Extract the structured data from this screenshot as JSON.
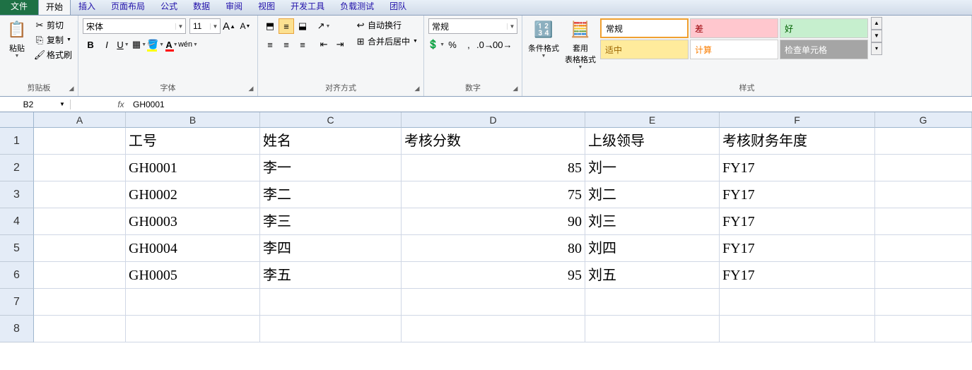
{
  "tabs": {
    "file": "文件",
    "items": [
      "开始",
      "插入",
      "页面布局",
      "公式",
      "数据",
      "审阅",
      "视图",
      "开发工具",
      "负载测试",
      "团队"
    ],
    "active": 0
  },
  "ribbon": {
    "clipboard": {
      "label": "剪贴板",
      "paste": "粘贴",
      "cut": "剪切",
      "copy": "复制",
      "format_painter": "格式刷"
    },
    "font": {
      "label": "字体",
      "name": "宋体",
      "size": "11"
    },
    "alignment": {
      "label": "对齐方式",
      "wrap": "自动换行",
      "merge": "合并后居中"
    },
    "number": {
      "label": "数字",
      "format": "常规"
    },
    "styles": {
      "label": "样式",
      "cond_fmt": "条件格式",
      "table_fmt": "套用\n表格格式",
      "cells": [
        {
          "t": "常规",
          "bg": "#ffffff",
          "bd": "#f0c36d",
          "sel": true
        },
        {
          "t": "差",
          "bg": "#ffc7ce",
          "c": "#9c0006"
        },
        {
          "t": "好",
          "bg": "#c6efce",
          "c": "#006100"
        },
        {
          "t": "适中",
          "bg": "#ffeb9c",
          "c": "#9c6500"
        },
        {
          "t": "计算",
          "bg": "#ffffff",
          "c": "#fa7d00"
        },
        {
          "t": "检查单元格",
          "bg": "#a5a5a5",
          "c": "#ffffff"
        }
      ]
    }
  },
  "formula_bar": {
    "name_box": "B2",
    "fx": "fx",
    "value": "GH0001"
  },
  "grid": {
    "columns": [
      "A",
      "B",
      "C",
      "D",
      "E",
      "F",
      "G"
    ],
    "col_widths": [
      "cw-A",
      "cw-B",
      "cw-C",
      "cw-D",
      "cw-E",
      "cw-F",
      "cw-G"
    ],
    "rows": [
      {
        "n": "1",
        "c": [
          "",
          "工号",
          "姓名",
          "考核分数",
          "上级领导",
          "考核财务年度",
          ""
        ]
      },
      {
        "n": "2",
        "c": [
          "",
          "GH0001",
          "李一",
          "85",
          "刘一",
          "FY17",
          ""
        ]
      },
      {
        "n": "3",
        "c": [
          "",
          "GH0002",
          "李二",
          "75",
          "刘二",
          "FY17",
          ""
        ]
      },
      {
        "n": "4",
        "c": [
          "",
          "GH0003",
          "李三",
          "90",
          "刘三",
          "FY17",
          ""
        ]
      },
      {
        "n": "5",
        "c": [
          "",
          "GH0004",
          "李四",
          "80",
          "刘四",
          "FY17",
          ""
        ]
      },
      {
        "n": "6",
        "c": [
          "",
          "GH0005",
          "李五",
          "95",
          "刘五",
          "FY17",
          ""
        ]
      },
      {
        "n": "7",
        "c": [
          "",
          "",
          "",
          "",
          "",
          "",
          ""
        ]
      },
      {
        "n": "8",
        "c": [
          "",
          "",
          "",
          "",
          "",
          "",
          ""
        ]
      }
    ],
    "numeric_col": 3
  }
}
